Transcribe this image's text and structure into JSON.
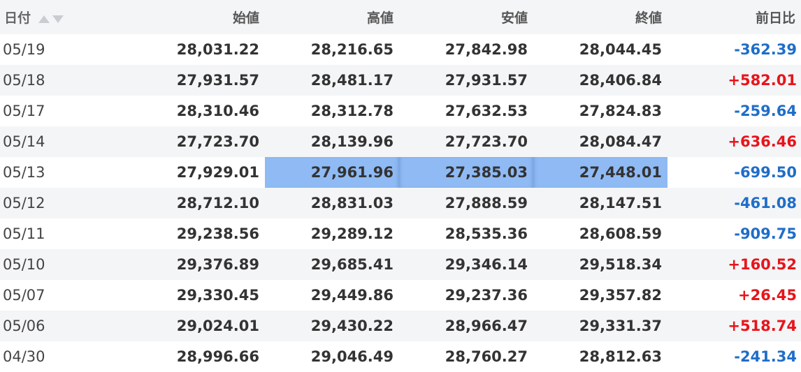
{
  "headers": {
    "date": "日付",
    "open": "始値",
    "high": "高値",
    "low": "安値",
    "close": "終値",
    "diff": "前日比"
  },
  "sort_icons": [
    "sort-asc-icon",
    "sort-desc-icon"
  ],
  "colors": {
    "negative": "#1f6dc9",
    "positive": "#e8141b",
    "selection": "#8fbaf4",
    "row_alt": "#f4f5f6"
  },
  "selected_row": 4,
  "rows": [
    {
      "date": "05/19",
      "open": "28,031.22",
      "high": "28,216.65",
      "low": "27,842.98",
      "close": "28,044.45",
      "diff": "-362.39"
    },
    {
      "date": "05/18",
      "open": "27,931.57",
      "high": "28,481.17",
      "low": "27,931.57",
      "close": "28,406.84",
      "diff": "+582.01"
    },
    {
      "date": "05/17",
      "open": "28,310.46",
      "high": "28,312.78",
      "low": "27,632.53",
      "close": "27,824.83",
      "diff": "-259.64"
    },
    {
      "date": "05/14",
      "open": "27,723.70",
      "high": "28,139.96",
      "low": "27,723.70",
      "close": "28,084.47",
      "diff": "+636.46"
    },
    {
      "date": "05/13",
      "open": "27,929.01",
      "high": "27,961.96",
      "low": "27,385.03",
      "close": "27,448.01",
      "diff": "-699.50"
    },
    {
      "date": "05/12",
      "open": "28,712.10",
      "high": "28,831.03",
      "low": "27,888.59",
      "close": "28,147.51",
      "diff": "-461.08"
    },
    {
      "date": "05/11",
      "open": "29,238.56",
      "high": "29,289.12",
      "low": "28,535.36",
      "close": "28,608.59",
      "diff": "-909.75"
    },
    {
      "date": "05/10",
      "open": "29,376.89",
      "high": "29,685.41",
      "low": "29,346.14",
      "close": "29,518.34",
      "diff": "+160.52"
    },
    {
      "date": "05/07",
      "open": "29,330.45",
      "high": "29,449.86",
      "low": "29,237.36",
      "close": "29,357.82",
      "diff": "+26.45"
    },
    {
      "date": "05/06",
      "open": "29,024.01",
      "high": "29,430.22",
      "low": "28,966.47",
      "close": "29,331.37",
      "diff": "+518.74"
    },
    {
      "date": "04/30",
      "open": "28,996.66",
      "high": "29,046.49",
      "low": "28,760.27",
      "close": "28,812.63",
      "diff": "-241.34"
    }
  ]
}
